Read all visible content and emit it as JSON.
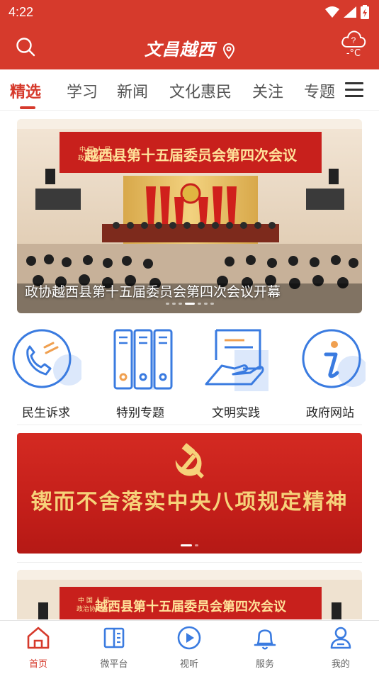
{
  "status_bar": {
    "time": "4:22"
  },
  "header": {
    "logo_text": "文昌越西",
    "weather_temp": "-°C",
    "weather_unknown": "?"
  },
  "tabs": [
    {
      "label": "精选",
      "active": true
    },
    {
      "label": "学习"
    },
    {
      "label": "新闻"
    },
    {
      "label": "文化惠民"
    },
    {
      "label": "关注"
    },
    {
      "label": "专题"
    }
  ],
  "hero": {
    "caption": "政协越西县第十五届委员会第四次会议开幕",
    "banner_text": "越西县第十五届委员会第四次会议",
    "org_text_line1": "中 国 人 民",
    "org_text_line2": "政治协商会议"
  },
  "quick_entries": [
    {
      "label": "民生诉求",
      "icon": "phone-icon"
    },
    {
      "label": "特别专题",
      "icon": "binders-icon"
    },
    {
      "label": "文明实践",
      "icon": "hand-document-icon"
    },
    {
      "label": "政府网站",
      "icon": "info-icon"
    }
  ],
  "promo_banner": {
    "slogan": "锲而不舍落实中央八项规定精神",
    "emblem": "hammer-sickle-icon"
  },
  "card2": {
    "banner_text": "越西县第十五届委员会第四次会议",
    "org_text_line1": "中 国 人 民",
    "org_text_line2": "政治协商会议"
  },
  "bottom_nav": [
    {
      "label": "首页",
      "icon": "home-icon",
      "active": true
    },
    {
      "label": "微平台",
      "icon": "book-icon"
    },
    {
      "label": "视听",
      "icon": "play-icon"
    },
    {
      "label": "服务",
      "icon": "bell-icon"
    },
    {
      "label": "我的",
      "icon": "user-icon"
    }
  ],
  "colors": {
    "brand_red": "#d63a2c",
    "icon_blue": "#3a7be0",
    "slogan_gold": "#f6d27a"
  }
}
